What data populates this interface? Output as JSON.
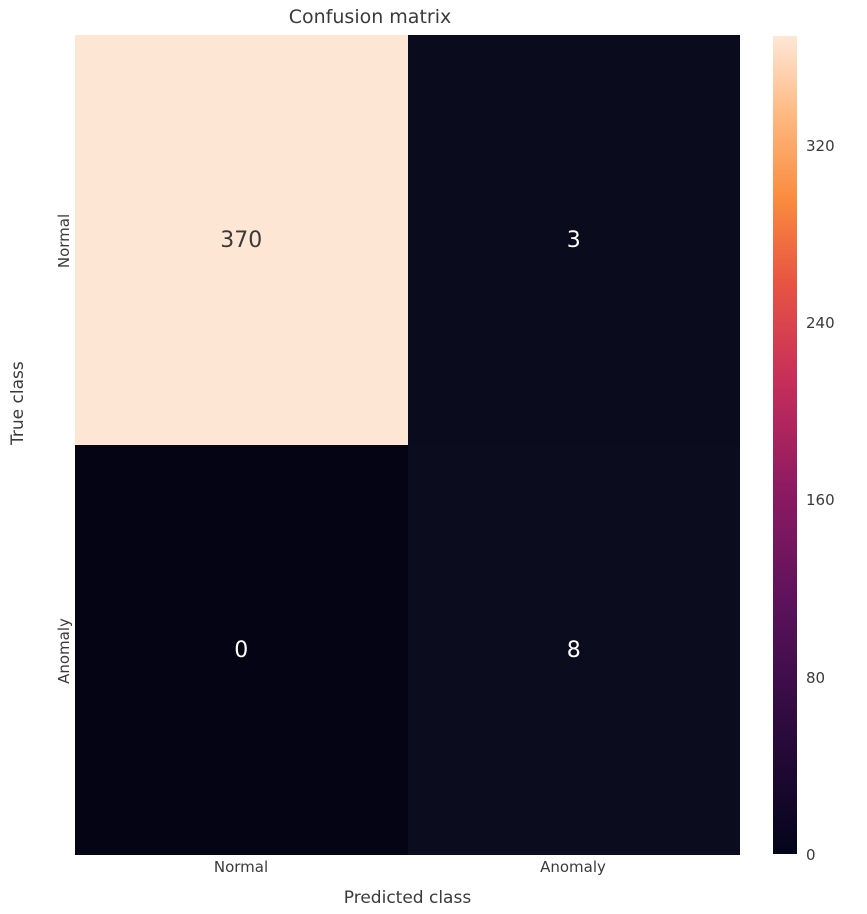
{
  "chart_data": {
    "type": "heatmap",
    "title": "Confusion matrix",
    "xlabel": "Predicted class",
    "ylabel": "True class",
    "x_categories": [
      "Normal",
      "Anomaly"
    ],
    "y_categories": [
      "Normal",
      "Anomaly"
    ],
    "values": [
      [
        370,
        3
      ],
      [
        0,
        8
      ]
    ],
    "cell_colors": [
      [
        "#fde6d4",
        "#0a0b1c"
      ],
      [
        "#040414",
        "#0c0c1f"
      ]
    ],
    "cell_text_colors": [
      [
        "#3a3a3a",
        "#ffffff"
      ],
      [
        "#ffffff",
        "#ffffff"
      ]
    ],
    "colorbar": {
      "ticks": [
        0,
        80,
        160,
        240,
        320
      ],
      "min": 0,
      "max": 370,
      "gradient": "linear-gradient(to top, #03051a 0%, #2b0a3d 15%, #5a125b 30%, #8f1a62 45%, #c62f59 58%, #e85542 70%, #f98b3f 80%, #feb77e 90%, #fee7d6 100%)"
    }
  }
}
